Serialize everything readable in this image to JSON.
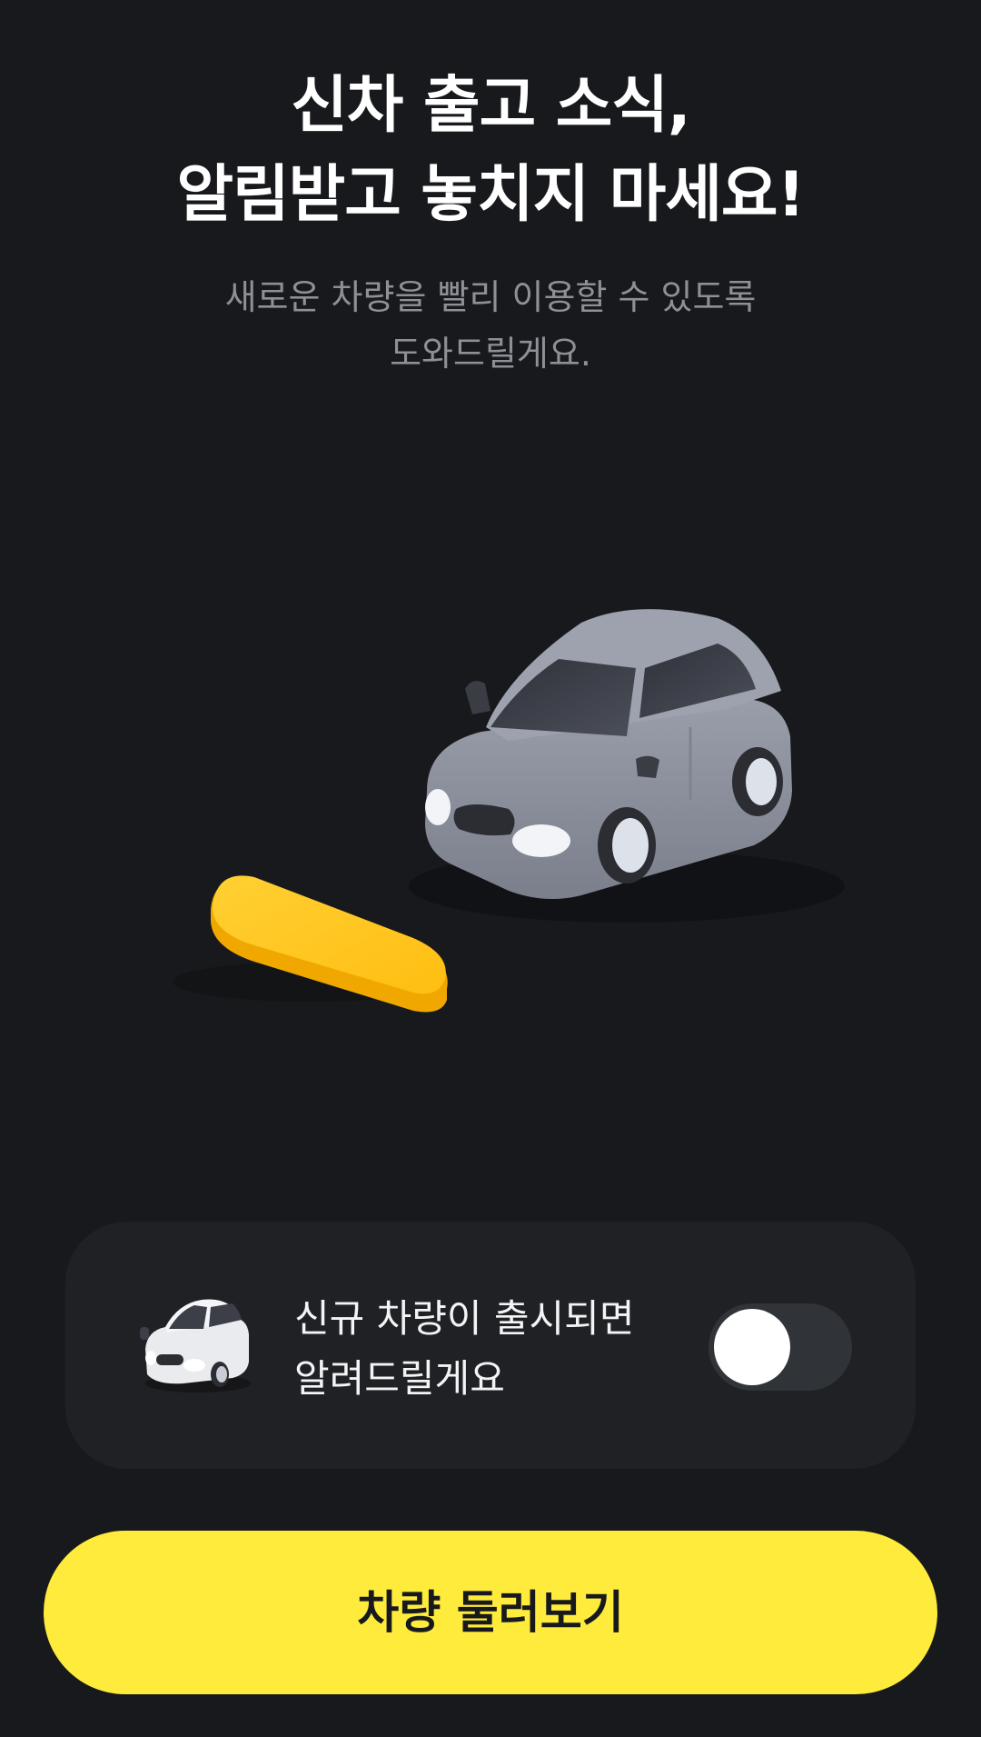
{
  "header": {
    "title_line1": "신차 출고 소식,",
    "title_line2": "알림받고 놓치지 마세요!",
    "subtitle_line1": "새로운 차량을 빨리 이용할 수 있도록",
    "subtitle_line2": "도와드릴게요."
  },
  "illustration": {
    "car_color": "#8b8f9c",
    "pill_color": "#ffc21a",
    "icons": [
      "car-illustration-icon",
      "yellow-pill-block-icon"
    ]
  },
  "notify_card": {
    "text_line1": "신규 차량이 출시되면",
    "text_line2": "알려드릴게요",
    "toggle_on": false,
    "icon": "white-car-icon"
  },
  "cta": {
    "label": "차량 둘러보기",
    "color": "#ffeb3b"
  },
  "colors": {
    "background": "#17191c",
    "card": "#1f2124",
    "subtitle": "#8d9096"
  }
}
